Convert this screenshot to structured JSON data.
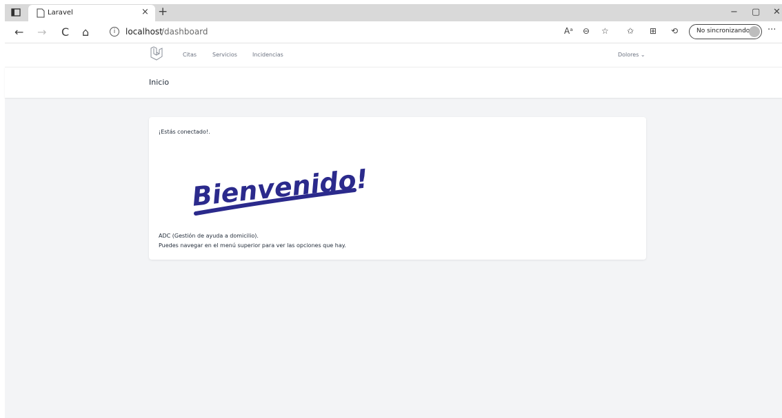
{
  "browser": {
    "tab_title": "Laravel",
    "url_host": "localhost",
    "url_path": "/dashboard",
    "sync_label": "No sincronizando",
    "icons": {
      "tab_toggle": "tab-actions-icon",
      "close_tab": "×",
      "new_tab": "+",
      "back": "←",
      "forward": "→",
      "refresh": "C",
      "home": "⌂",
      "read_aloud": "Aᵃ",
      "zoom": "⊖",
      "favorites_add": "☆",
      "favorites": "✩",
      "collections": "⊞",
      "history": "⟲",
      "more": "···",
      "minimize": "−",
      "restore": "▢",
      "close_window": "✕"
    }
  },
  "nav": {
    "links": [
      "Citas",
      "Servicios",
      "Incidencias"
    ],
    "user": "Dolores ⌄"
  },
  "header": {
    "title": "Inicio"
  },
  "content": {
    "status": "¡Estás conectado!.",
    "welcome_image_text": "Bienvenido!",
    "line1": "ADC (Gestión de ayuda a domicilio).",
    "line2": "Puedes navegar en el menú superior para ver las opciones que hay."
  },
  "colors": {
    "page_bg": "#f3f4f6",
    "welcome_ink": "#2b2a8c",
    "nav_text": "#6b7280"
  }
}
